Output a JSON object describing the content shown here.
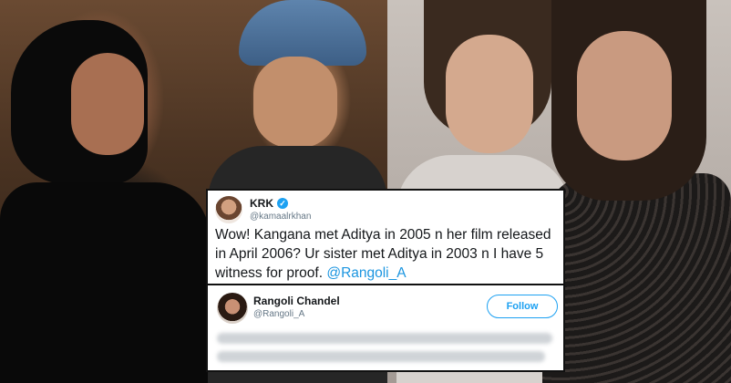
{
  "tweets": {
    "krk": {
      "name": "KRK",
      "handle": "@kamaalrkhan",
      "text_part1": "Wow! Kangana met Aditya in 2005 n her film released in April 2006? Ur sister met Aditya in 2003 n I have 5 witness for proof. ",
      "mention": "@Rangoli_A"
    },
    "rangoli": {
      "name": "Rangoli Chandel",
      "handle": "@Rangoli_A",
      "follow_label": "Follow"
    }
  },
  "icons": {
    "verified": "verified-badge-icon"
  },
  "colors": {
    "twitter_blue": "#1da1f2",
    "mention_blue": "#1b95e0"
  }
}
